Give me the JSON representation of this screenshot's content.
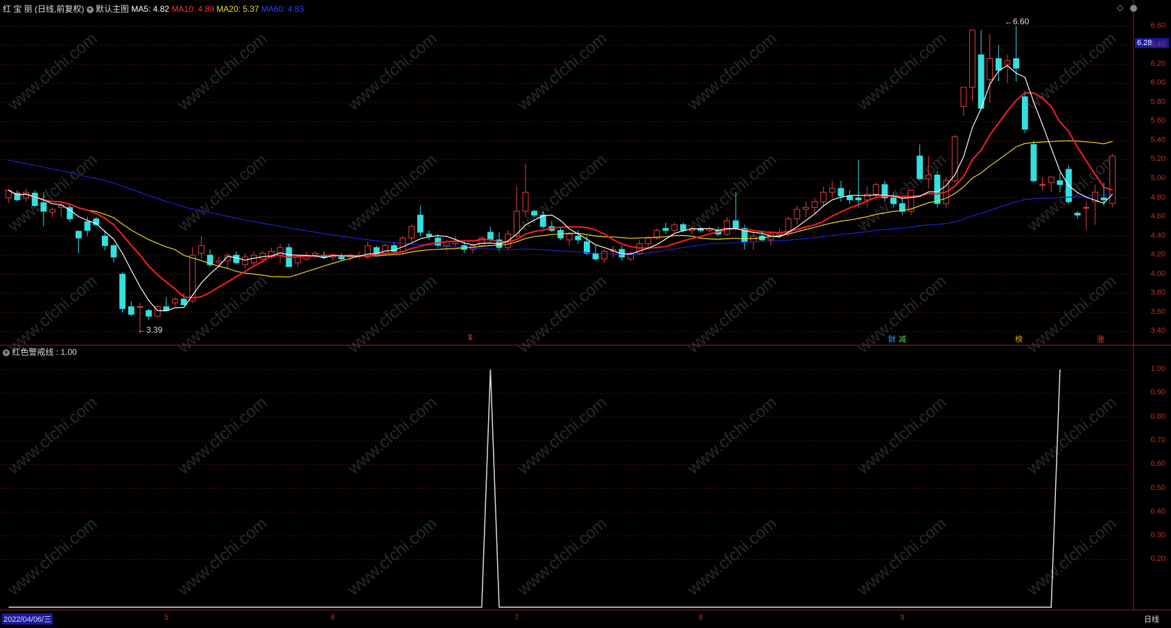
{
  "header": {
    "stock_name": "红 宝 丽",
    "mode": "(日线,前复权)",
    "main_chart_label": "默认主图",
    "ma5_label": "MA5: 4.82",
    "ma10_label": "MA10: 4.89",
    "ma20_label": "MA20: 5.37",
    "ma60_label": "MA60: 4.83"
  },
  "indicator_header": {
    "label": "红色警戒线 : 1.00"
  },
  "price_panel": {
    "current_price_tag": "6.28",
    "high_marker": "6.60",
    "low_marker": "3.39",
    "event_tags": [
      "$",
      "财",
      "减",
      "榜",
      "涨"
    ],
    "y_ticks": [
      "6.60",
      "6.40",
      "6.20",
      "6.00",
      "5.80",
      "5.60",
      "5.40",
      "5.20",
      "5.00",
      "4.80",
      "4.60",
      "4.40",
      "4.20",
      "4.00",
      "3.80",
      "3.60",
      "3.40"
    ]
  },
  "indicator_panel": {
    "y_ticks": [
      "1.00",
      "0.90",
      "0.80",
      "0.70",
      "0.60",
      "0.50",
      "0.40",
      "0.30",
      "0.20"
    ]
  },
  "x_axis": {
    "start_date": "2022/04/06/三",
    "month_ticks": [
      "5",
      "6",
      "7",
      "8",
      "9"
    ],
    "period_label": "日线"
  },
  "watermark": "www.cfchi.com",
  "colors": {
    "up": "#e84040",
    "down": "#33e0e0",
    "ma5": "#ffffff",
    "ma10": "#ff2020",
    "ma20": "#e8e020",
    "ma60": "#2020d0",
    "grid": "#5a1010",
    "axis_text": "#c03030"
  },
  "chart_data": {
    "type": "candlestick",
    "x": [
      "2022-04-06",
      "2022-04-07",
      "2022-04-08",
      "2022-04-11",
      "2022-04-12",
      "2022-04-13",
      "2022-04-14",
      "2022-04-15",
      "2022-04-18",
      "2022-04-19",
      "2022-04-20",
      "2022-04-21",
      "2022-04-22",
      "2022-04-25",
      "2022-04-26",
      "2022-04-27",
      "2022-04-28",
      "2022-04-29",
      "2022-05-05",
      "2022-05-06",
      "2022-05-09",
      "2022-05-10",
      "2022-05-11",
      "2022-05-12",
      "2022-05-13",
      "2022-05-16",
      "2022-05-17",
      "2022-05-18",
      "2022-05-19",
      "2022-05-20",
      "2022-05-23",
      "2022-05-24",
      "2022-05-25",
      "2022-05-26",
      "2022-05-27",
      "2022-05-30",
      "2022-05-31",
      "2022-06-01",
      "2022-06-02",
      "2022-06-06",
      "2022-06-07",
      "2022-06-08",
      "2022-06-09",
      "2022-06-10",
      "2022-06-13",
      "2022-06-14",
      "2022-06-15",
      "2022-06-16",
      "2022-06-17",
      "2022-06-20",
      "2022-06-21",
      "2022-06-22",
      "2022-06-23",
      "2022-06-24",
      "2022-06-27",
      "2022-06-28",
      "2022-06-29",
      "2022-06-30",
      "2022-07-01",
      "2022-07-04",
      "2022-07-05",
      "2022-07-06",
      "2022-07-07",
      "2022-07-08",
      "2022-07-11",
      "2022-07-12",
      "2022-07-13",
      "2022-07-14",
      "2022-07-15",
      "2022-07-18",
      "2022-07-19",
      "2022-07-20",
      "2022-07-21",
      "2022-07-22",
      "2022-07-25",
      "2022-07-26",
      "2022-07-27",
      "2022-07-28",
      "2022-07-29",
      "2022-08-01",
      "2022-08-02",
      "2022-08-03",
      "2022-08-04",
      "2022-08-05",
      "2022-08-08",
      "2022-08-09",
      "2022-08-10",
      "2022-08-11",
      "2022-08-12",
      "2022-08-15",
      "2022-08-16",
      "2022-08-17",
      "2022-08-18",
      "2022-08-19",
      "2022-08-22",
      "2022-08-23",
      "2022-08-24",
      "2022-08-25",
      "2022-08-26",
      "2022-08-29",
      "2022-08-30",
      "2022-08-31",
      "2022-09-01",
      "2022-09-02",
      "2022-09-05",
      "2022-09-06",
      "2022-09-07",
      "2022-09-08",
      "2022-09-09",
      "2022-09-13",
      "2022-09-14",
      "2022-09-15",
      "2022-09-16",
      "2022-09-19",
      "2022-09-20",
      "2022-09-21",
      "2022-09-22",
      "2022-09-23",
      "2022-09-26",
      "2022-09-27",
      "2022-09-28"
    ],
    "ohlc": [
      [
        4.8,
        4.9,
        4.75,
        4.88
      ],
      [
        4.85,
        4.88,
        4.76,
        4.78
      ],
      [
        4.8,
        4.9,
        4.76,
        4.86
      ],
      [
        4.85,
        4.88,
        4.7,
        4.72
      ],
      [
        4.75,
        4.86,
        4.5,
        4.66
      ],
      [
        4.65,
        4.7,
        4.6,
        4.68
      ],
      [
        4.7,
        4.76,
        4.6,
        4.72
      ],
      [
        4.7,
        4.74,
        4.55,
        4.58
      ],
      [
        4.45,
        4.46,
        4.22,
        4.38
      ],
      [
        4.55,
        4.6,
        4.4,
        4.46
      ],
      [
        4.58,
        4.6,
        4.5,
        4.52
      ],
      [
        4.4,
        4.46,
        4.25,
        4.3
      ],
      [
        4.3,
        4.32,
        4.12,
        4.18
      ],
      [
        4.0,
        4.02,
        3.6,
        3.64
      ],
      [
        3.66,
        3.72,
        3.56,
        3.58
      ],
      [
        3.66,
        3.7,
        3.39,
        3.66
      ],
      [
        3.62,
        3.64,
        3.52,
        3.56
      ],
      [
        3.56,
        3.68,
        3.55,
        3.66
      ],
      [
        3.66,
        3.76,
        3.62,
        3.62
      ],
      [
        3.7,
        3.76,
        3.66,
        3.74
      ],
      [
        3.74,
        3.8,
        3.68,
        3.68
      ],
      [
        3.72,
        4.28,
        3.7,
        4.2
      ],
      [
        4.22,
        4.4,
        4.16,
        4.3
      ],
      [
        4.2,
        4.26,
        4.08,
        4.1
      ],
      [
        4.12,
        4.18,
        4.08,
        4.14
      ],
      [
        4.14,
        4.22,
        4.06,
        4.2
      ],
      [
        4.2,
        4.24,
        4.1,
        4.12
      ],
      [
        4.1,
        4.22,
        4.06,
        4.18
      ],
      [
        4.12,
        4.24,
        4.08,
        4.2
      ],
      [
        4.16,
        4.24,
        4.12,
        4.22
      ],
      [
        4.18,
        4.28,
        4.16,
        4.24
      ],
      [
        4.2,
        4.32,
        4.12,
        4.28
      ],
      [
        4.28,
        4.32,
        4.1,
        4.08
      ],
      [
        4.12,
        4.2,
        4.08,
        4.18
      ],
      [
        4.16,
        4.24,
        4.14,
        4.2
      ],
      [
        4.2,
        4.24,
        4.16,
        4.22
      ],
      [
        4.2,
        4.24,
        4.16,
        4.18
      ],
      [
        4.18,
        4.22,
        4.14,
        4.2
      ],
      [
        4.18,
        4.22,
        4.14,
        4.16
      ],
      [
        4.18,
        4.22,
        4.14,
        4.2
      ],
      [
        4.2,
        4.24,
        4.16,
        4.2
      ],
      [
        4.18,
        4.34,
        4.16,
        4.3
      ],
      [
        4.28,
        4.3,
        4.2,
        4.22
      ],
      [
        4.22,
        4.32,
        4.2,
        4.3
      ],
      [
        4.3,
        4.34,
        4.22,
        4.24
      ],
      [
        4.24,
        4.4,
        4.22,
        4.38
      ],
      [
        4.38,
        4.52,
        4.34,
        4.5
      ],
      [
        4.62,
        4.72,
        4.4,
        4.44
      ],
      [
        4.42,
        4.46,
        4.36,
        4.4
      ],
      [
        4.38,
        4.42,
        4.28,
        4.3
      ],
      [
        4.3,
        4.36,
        4.24,
        4.34
      ],
      [
        4.32,
        4.4,
        4.28,
        4.34
      ],
      [
        4.3,
        4.34,
        4.22,
        4.26
      ],
      [
        4.26,
        4.32,
        4.22,
        4.3
      ],
      [
        4.3,
        4.4,
        4.28,
        4.38
      ],
      [
        4.44,
        4.5,
        4.34,
        4.36
      ],
      [
        4.36,
        4.44,
        4.24,
        4.28
      ],
      [
        4.28,
        4.46,
        4.26,
        4.42
      ],
      [
        4.4,
        4.92,
        4.38,
        4.66
      ],
      [
        4.66,
        5.16,
        4.6,
        4.86
      ],
      [
        4.66,
        4.68,
        4.6,
        4.62
      ],
      [
        4.62,
        4.66,
        4.48,
        4.5
      ],
      [
        4.5,
        4.56,
        4.44,
        4.46
      ],
      [
        4.46,
        4.5,
        4.36,
        4.38
      ],
      [
        4.36,
        4.44,
        4.3,
        4.42
      ],
      [
        4.4,
        4.46,
        4.32,
        4.36
      ],
      [
        4.34,
        4.4,
        4.2,
        4.22
      ],
      [
        4.22,
        4.3,
        4.14,
        4.16
      ],
      [
        4.16,
        4.26,
        4.12,
        4.24
      ],
      [
        4.24,
        4.3,
        4.18,
        4.26
      ],
      [
        4.26,
        4.3,
        4.14,
        4.18
      ],
      [
        4.16,
        4.24,
        4.14,
        4.22
      ],
      [
        4.22,
        4.36,
        4.2,
        4.32
      ],
      [
        4.32,
        4.4,
        4.28,
        4.38
      ],
      [
        4.38,
        4.48,
        4.36,
        4.46
      ],
      [
        4.48,
        4.54,
        4.42,
        4.46
      ],
      [
        4.46,
        4.54,
        4.44,
        4.52
      ],
      [
        4.52,
        4.54,
        4.44,
        4.46
      ],
      [
        4.46,
        4.5,
        4.42,
        4.48
      ],
      [
        4.48,
        4.5,
        4.44,
        4.46
      ],
      [
        4.46,
        4.5,
        4.44,
        4.48
      ],
      [
        4.46,
        4.5,
        4.4,
        4.42
      ],
      [
        4.42,
        4.6,
        4.4,
        4.56
      ],
      [
        4.56,
        4.86,
        4.46,
        4.48
      ],
      [
        4.48,
        4.52,
        4.26,
        4.34
      ],
      [
        4.34,
        4.44,
        4.26,
        4.4
      ],
      [
        4.4,
        4.46,
        4.34,
        4.36
      ],
      [
        4.36,
        4.44,
        4.3,
        4.42
      ],
      [
        4.42,
        4.48,
        4.38,
        4.44
      ],
      [
        4.44,
        4.6,
        4.4,
        4.58
      ],
      [
        4.58,
        4.72,
        4.52,
        4.68
      ],
      [
        4.68,
        4.76,
        4.6,
        4.7
      ],
      [
        4.7,
        4.8,
        4.62,
        4.76
      ],
      [
        4.76,
        4.92,
        4.7,
        4.86
      ],
      [
        4.86,
        4.98,
        4.8,
        4.9
      ],
      [
        4.9,
        4.98,
        4.76,
        4.82
      ],
      [
        4.82,
        4.88,
        4.74,
        4.78
      ],
      [
        4.8,
        5.2,
        4.7,
        4.78
      ],
      [
        4.78,
        4.92,
        4.7,
        4.84
      ],
      [
        4.84,
        4.96,
        4.78,
        4.94
      ],
      [
        4.94,
        4.98,
        4.76,
        4.8
      ],
      [
        4.8,
        4.86,
        4.7,
        4.74
      ],
      [
        4.74,
        4.8,
        4.62,
        4.66
      ],
      [
        4.66,
        4.88,
        4.62,
        4.88
      ],
      [
        5.24,
        5.36,
        4.98,
        5.0
      ],
      [
        5.0,
        5.24,
        4.9,
        5.04
      ],
      [
        5.04,
        5.08,
        4.7,
        4.74
      ],
      [
        4.74,
        5.02,
        4.7,
        4.98
      ],
      [
        4.98,
        5.46,
        4.96,
        5.44
      ],
      [
        5.76,
        5.92,
        5.66,
        5.96
      ],
      [
        5.96,
        6.56,
        5.82,
        6.56
      ],
      [
        6.3,
        6.56,
        5.72,
        5.74
      ],
      [
        6.04,
        6.52,
        5.8,
        6.26
      ],
      [
        6.26,
        6.4,
        6.02,
        6.14
      ],
      [
        6.2,
        6.3,
        6.0,
        6.24
      ],
      [
        6.26,
        6.6,
        6.02,
        6.16
      ],
      [
        5.86,
        5.92,
        5.48,
        5.52
      ],
      [
        5.36,
        5.4,
        4.96,
        4.98
      ],
      [
        4.94,
        5.02,
        4.88,
        4.94
      ],
      [
        4.96,
        5.0,
        4.86,
        5.02
      ],
      [
        4.98,
        5.06,
        4.86,
        4.94
      ],
      [
        5.1,
        5.14,
        4.74,
        4.76
      ],
      [
        4.64,
        4.66,
        4.58,
        4.62
      ],
      [
        4.7,
        4.76,
        4.46,
        4.7
      ],
      [
        4.76,
        4.94,
        4.52,
        4.86
      ],
      [
        4.8,
        4.96,
        4.72,
        4.78
      ],
      [
        4.74,
        5.26,
        4.7,
        5.24
      ]
    ],
    "indicator": {
      "name": "红色警戒线",
      "baseline": 0,
      "spikes_at": [
        "2022-06-28",
        "2022-09-28"
      ],
      "spike_value": 1.0,
      "ylim": [
        0,
        1.05
      ]
    },
    "ylim": [
      3.3,
      6.7
    ]
  }
}
